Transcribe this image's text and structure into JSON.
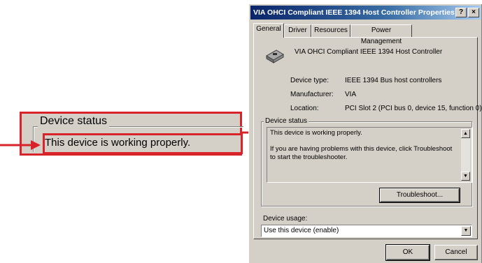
{
  "callout": {
    "legend": "Device status",
    "text": "This device is working properly."
  },
  "dialog": {
    "title": "VIA OHCI Compliant IEEE 1394 Host Controller Properties",
    "help_btn": "?",
    "close_btn": "×",
    "tabs": [
      {
        "label": "General",
        "active": true
      },
      {
        "label": "Driver"
      },
      {
        "label": "Resources"
      },
      {
        "label": "Power Management"
      }
    ],
    "device_name": "VIA OHCI Compliant IEEE 1394 Host Controller",
    "properties": {
      "type_label": "Device type:",
      "type_value": "IEEE 1394 Bus host controllers",
      "manufacturer_label": "Manufacturer:",
      "manufacturer_value": "VIA",
      "location_label": "Location:",
      "location_value": "PCI Slot 2 (PCI bus 0, device 15, function 0)"
    },
    "status": {
      "legend": "Device status",
      "line1": "This device is working properly.",
      "line2": "If you are having problems with this device, click Troubleshoot to start the troubleshooter."
    },
    "troubleshoot_btn": "Troubleshoot...",
    "usage": {
      "label": "Device usage:",
      "selected": "Use this device (enable)"
    },
    "ok_btn": "OK",
    "cancel_btn": "Cancel"
  },
  "colors": {
    "callout_red": "#d8232a",
    "dialog_face": "#d4d0c8",
    "titlebar_start": "#0a246a",
    "titlebar_end": "#a6caf0"
  }
}
